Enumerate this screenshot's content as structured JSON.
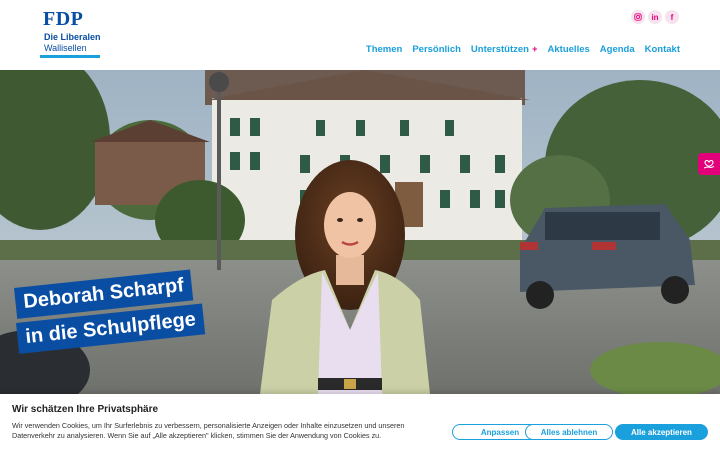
{
  "logo": {
    "brand": "FDP",
    "line1": "Die Liberalen",
    "line2": "Wallisellen"
  },
  "social": [
    {
      "icon": "instagram-icon",
      "label": ""
    },
    {
      "icon": "linkedin-icon",
      "label": "in"
    },
    {
      "icon": "facebook-icon",
      "label": "f"
    }
  ],
  "nav": {
    "items": [
      "Themen",
      "Persönlich",
      "Unterstützen",
      "Aktuelles",
      "Agenda",
      "Kontakt"
    ],
    "expand_symbol": "+"
  },
  "hero": {
    "headline_line1": "Deborah Scharpf",
    "headline_line2": "in die Schulpflege",
    "side_tab_icon": "heart-hand-icon"
  },
  "cookie": {
    "title": "Wir schätzen Ihre Privatsphäre",
    "text": "Wir verwenden Cookies, um Ihr Surferlebnis zu verbessern, personalisierte Anzeigen oder Inhalte einzusetzen und unseren Datenverkehr zu analysieren. Wenn Sie auf „Alle akzeptieren\" klicken, stimmen Sie der Anwendung von Cookies zu.",
    "btn_customize": "Anpassen",
    "btn_reject": "Alles ablehnen",
    "btn_accept": "Alle akzeptieren"
  },
  "colors": {
    "fdp_blue": "#0a4ea3",
    "accent_cyan": "#1aa0dc",
    "magenta": "#e2007a"
  }
}
